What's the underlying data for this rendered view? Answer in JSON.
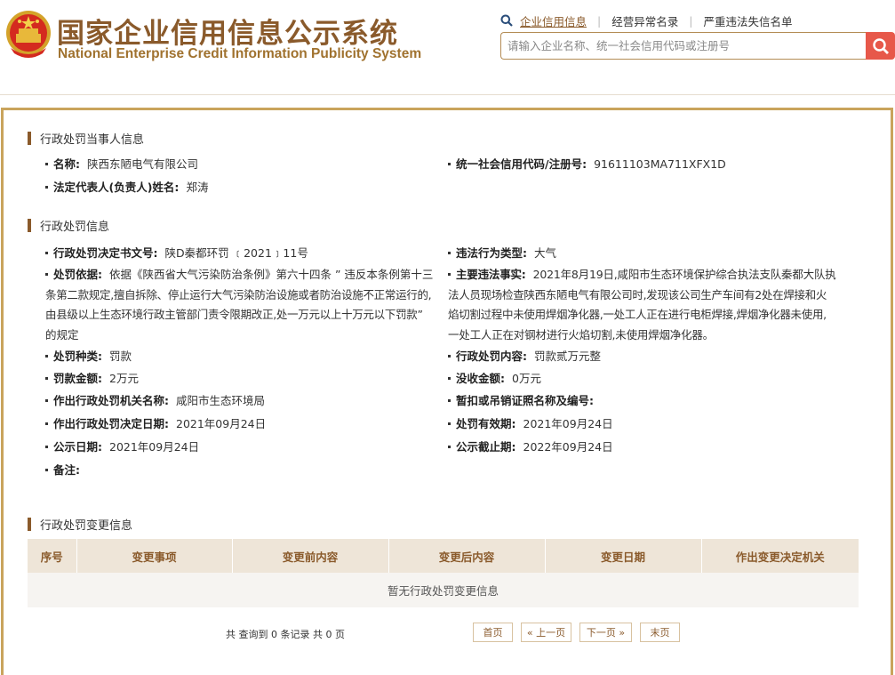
{
  "header": {
    "title_cn": "国家企业信用信息公示系统",
    "title_en": "National Enterprise Credit Information Publicity System",
    "nav": [
      "企业信用信息",
      "经营异常名录",
      "严重违法失信名单"
    ],
    "search_placeholder": "请输入企业名称、统一社会信用代码或注册号"
  },
  "section1": {
    "title": "行政处罚当事人信息",
    "name_label": "名称:",
    "name_value": "陕西东陋电气有限公司",
    "code_label": "统一社会信用代码/注册号:",
    "code_value": "91611103MA711XFX1D",
    "rep_label": "法定代表人(负责人)姓名:",
    "rep_value": "郑涛"
  },
  "section2": {
    "title": "行政处罚信息",
    "doc_label": "行政处罚决定书文号:",
    "doc_value": "陕D秦都环罚 ﹝2021﹞11号",
    "type_label": "违法行为类型:",
    "type_value": "大气",
    "basis_label": "处罚依据:",
    "basis_lines": [
      "依据《陕西省大气污染防治条例》第六十四条 ” 违反本条例第十三",
      "条第二款规定,擅自拆除、停止运行大气污染防治设施或者防治设施不正常运行的,",
      "由县级以上生态环境行政主管部门责令限期改正,处一万元以上十万元以下罚款”",
      "的规定"
    ],
    "facts_label": "主要违法事实:",
    "facts_lines": [
      "2021年8月19日,咸阳市生态环境保护综合执法支队秦都大队执",
      "法人员现场检查陕西东陋电气有限公司时,发现该公司生产车间有2处在焊接和火",
      "焰切割过程中未使用焊烟净化器,一处工人正在进行电柜焊接,焊烟净化器未使用,",
      "一处工人正在对钢材进行火焰切割,未使用焊烟净化器。"
    ],
    "kind_label": "处罚种类:",
    "kind_value": "罚款",
    "content_label": "行政处罚内容:",
    "content_value": "罚款贰万元整",
    "fine_label": "罚款金额:",
    "fine_value": "2万元",
    "confiscate_label": "没收金额:",
    "confiscate_value": "0万元",
    "org_label": "作出行政处罚机关名称:",
    "org_value": "咸阳市生态环境局",
    "license_label": "暂扣或吊销证照名称及编号:",
    "license_value": "",
    "date_label": "作出行政处罚决定日期:",
    "date_value": "2021年09月24日",
    "valid_label": "处罚有效期:",
    "valid_value": "2021年09月24日",
    "pub_label": "公示日期:",
    "pub_value": "2021年09月24日",
    "end_label": "公示截止期:",
    "end_value": "2022年09月24日",
    "note_label": "备注:",
    "note_value": ""
  },
  "section3": {
    "title": "行政处罚变更信息",
    "columns": [
      "序号",
      "变更事项",
      "变更前内容",
      "变更后内容",
      "变更日期",
      "作出变更决定机关"
    ],
    "empty_text": "暂无行政处罚变更信息"
  },
  "pager": {
    "info": "共 查询到 0 条记录 共 0 页",
    "first": "首页",
    "prev": "« 上一页",
    "next": "下一页 »",
    "last": "末页"
  }
}
